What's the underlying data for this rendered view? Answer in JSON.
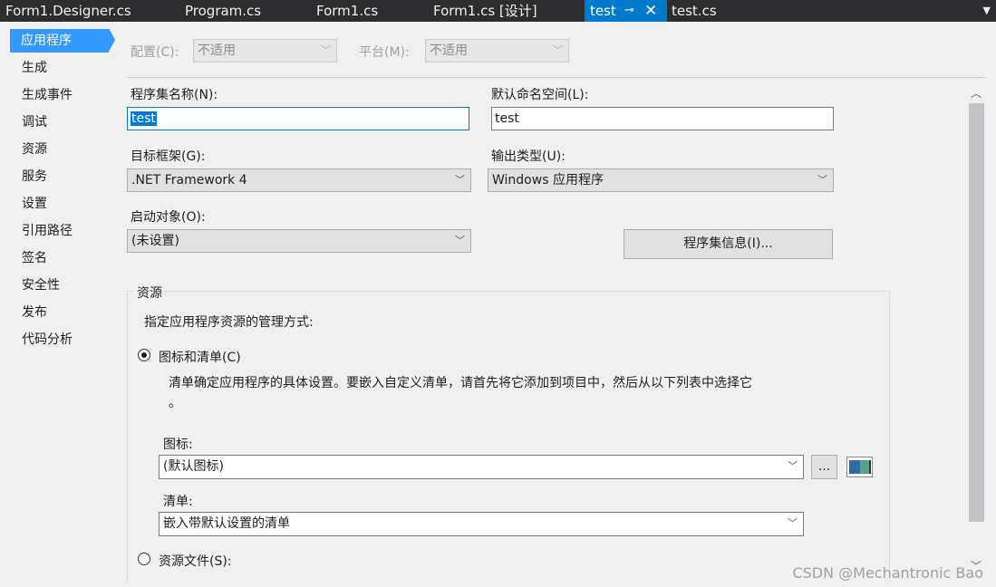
{
  "tabs": [
    {
      "label": "Form1.Designer.cs"
    },
    {
      "label": "Program.cs"
    },
    {
      "label": "Form1.cs"
    },
    {
      "label": "Form1.cs [设计]"
    },
    {
      "label": "test"
    },
    {
      "label": "test.cs"
    }
  ],
  "tab_icons": {
    "pin": "⊸",
    "close": "✕",
    "overflow": "▼"
  },
  "nav": [
    {
      "label": "应用程序"
    },
    {
      "label": "生成"
    },
    {
      "label": "生成事件"
    },
    {
      "label": "调试"
    },
    {
      "label": "资源"
    },
    {
      "label": "服务"
    },
    {
      "label": "设置"
    },
    {
      "label": "引用路径"
    },
    {
      "label": "签名"
    },
    {
      "label": "安全性"
    },
    {
      "label": "发布"
    },
    {
      "label": "代码分析"
    }
  ],
  "config": {
    "config_label": "配置(C):",
    "config_value": "不适用",
    "platform_label": "平台(M):",
    "platform_value": "不适用"
  },
  "form": {
    "assembly_label": "程序集名称(N):",
    "assembly_value": "test",
    "namespace_label": "默认命名空间(L):",
    "namespace_value": "test",
    "framework_label": "目标框架(G):",
    "framework_value": ".NET Framework 4",
    "output_label": "输出类型(U):",
    "output_value": "Windows 应用程序",
    "startup_label": "启动对象(O):",
    "startup_value": "(未设置)",
    "assembly_info_button": "程序集信息(I)..."
  },
  "resources": {
    "group_title": "资源",
    "description": "指定应用程序资源的管理方式:",
    "icon_manifest_option": "图标和清单(C)",
    "icon_manifest_help_line1": "清单确定应用程序的具体设置。要嵌入自定义清单，请首先将它添加到项目中，然后从以下列表中选择它",
    "icon_manifest_help_line2": "。",
    "icon_label": "图标:",
    "icon_value": "(默认图标)",
    "browse_button": "...",
    "manifest_label": "清单:",
    "manifest_value": "嵌入带默认设置的清单",
    "resource_file_option": "资源文件(S):"
  },
  "watermark": "CSDN @Mechantronic Bao",
  "colors": {
    "accent": "#007acc",
    "selection": "#3399ff"
  }
}
